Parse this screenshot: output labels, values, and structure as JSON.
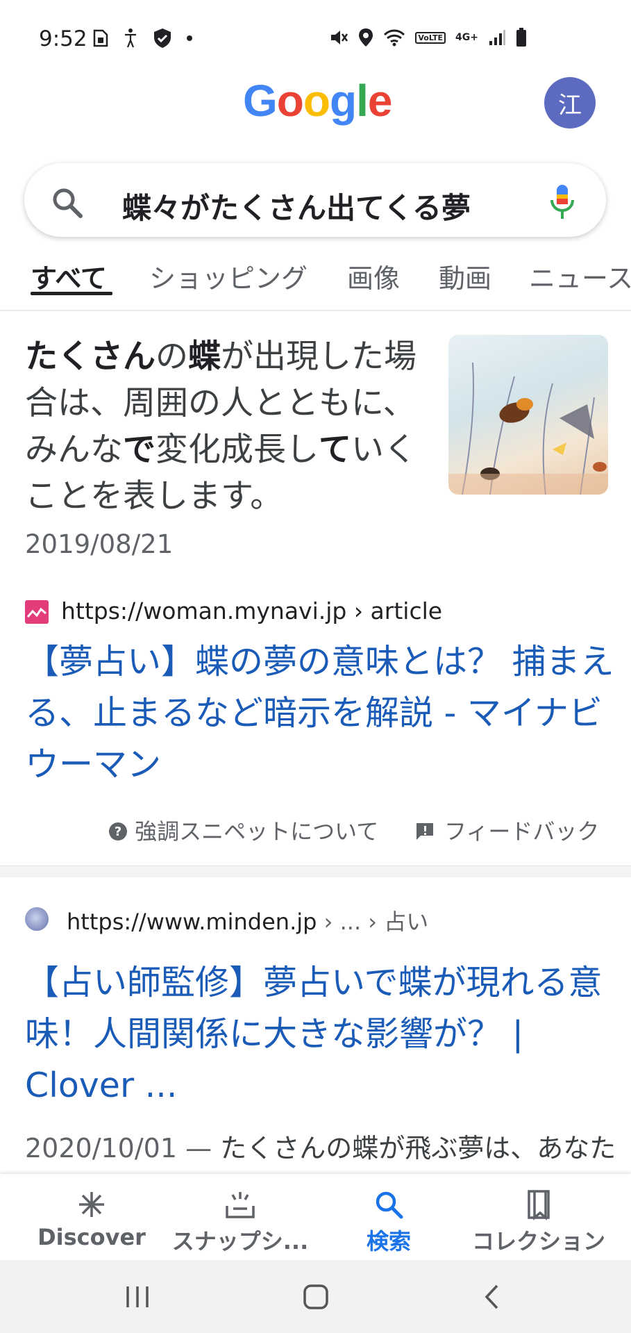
{
  "status_bar": {
    "time": "9:52",
    "left_icons": [
      "sim-card-icon",
      "accessibility-icon",
      "shield-icon",
      "dot-icon"
    ],
    "right_icons": [
      "mute-icon",
      "location-icon",
      "wifi-icon",
      "volte-icon",
      "4g-icon",
      "signal-icon",
      "battery-icon"
    ],
    "volte_label": "VoLTE",
    "network_label": "4G+"
  },
  "header": {
    "logo_letters": [
      {
        "ch": "G",
        "color": "#4285F4"
      },
      {
        "ch": "o",
        "color": "#EA4335"
      },
      {
        "ch": "o",
        "color": "#FBBC05"
      },
      {
        "ch": "g",
        "color": "#4285F4"
      },
      {
        "ch": "l",
        "color": "#34A853"
      },
      {
        "ch": "e",
        "color": "#EA4335"
      }
    ],
    "avatar_initial": "江",
    "avatar_color": "#5c6bc0"
  },
  "search": {
    "query": "蝶々がたくさん出てくる夢"
  },
  "tabs": [
    {
      "label": "すべて",
      "active": true
    },
    {
      "label": "ショッピング",
      "active": false
    },
    {
      "label": "画像",
      "active": false
    },
    {
      "label": "動画",
      "active": false
    },
    {
      "label": "ニュース",
      "active": false
    }
  ],
  "featured_snippet": {
    "date": "2019/08/21",
    "source_url": "https://woman.mynavi.jp",
    "source_path": "› article",
    "title": "【夢占い】蝶の夢の意味とは？ 捕まえる、止まるなど暗示を解説 - マイナビウーマン",
    "about_label": "強調スニペットについて",
    "feedback_label": "フィードバック"
  },
  "result2": {
    "url": "https://www.minden.jp",
    "crumbs": "› ... › 占い",
    "title": "【占い師監修】夢占いで蝶が現れる意味！人間関係に大きな影響が？ | Clover ...",
    "date": "2020/10/01",
    "dash": " — ",
    "snippet": "たくさんの蝶が飛ぶ夢は、あなた"
  },
  "bottom_nav": [
    {
      "label": "Discover",
      "icon": "asterisk-icon",
      "active": false
    },
    {
      "label": "スナップシ...",
      "icon": "snapshot-icon",
      "active": false
    },
    {
      "label": "検索",
      "icon": "search-icon",
      "active": true
    },
    {
      "label": "コレクション",
      "icon": "collections-icon",
      "active": false
    }
  ],
  "colors": {
    "link": "#1a5bb8",
    "accent": "#1a73e8"
  }
}
